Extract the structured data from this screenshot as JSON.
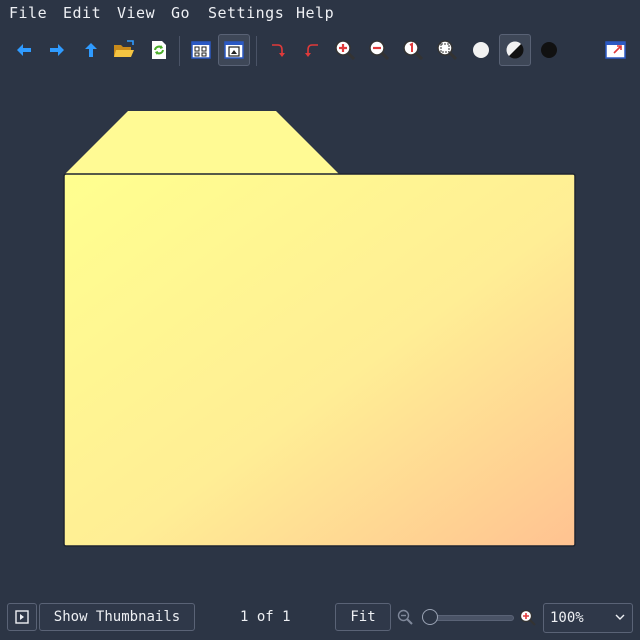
{
  "menu": [
    "File",
    "Edit",
    "View",
    "Go",
    "Settings",
    "Help"
  ],
  "toolbar": {
    "buttons": [
      {
        "name": "back-arrow-icon"
      },
      {
        "name": "forward-arrow-icon"
      },
      {
        "name": "up-arrow-icon"
      },
      {
        "name": "open-folder-icon"
      },
      {
        "name": "reload-icon"
      },
      {
        "name": "thumbnails-view-icon"
      },
      {
        "name": "image-view-icon",
        "active": true
      },
      {
        "name": "rotate-clockwise-icon"
      },
      {
        "name": "rotate-counterclockwise-icon"
      },
      {
        "name": "zoom-in-icon"
      },
      {
        "name": "zoom-out-icon"
      },
      {
        "name": "zoom-original-icon"
      },
      {
        "name": "zoom-fit-icon"
      },
      {
        "name": "light-background-icon"
      },
      {
        "name": "contrast-background-icon",
        "active": true
      },
      {
        "name": "dark-background-icon"
      },
      {
        "name": "fullscreen-icon"
      }
    ]
  },
  "viewer": {
    "image": "folder-icon",
    "colors": {
      "folder_light": "#ffff8f",
      "folder_dark": "#ffc291",
      "tab": "#fffa94"
    }
  },
  "statusbar": {
    "sidebar_toggle_icon": "sidebar-toggle-icon",
    "show_thumbnails_label": "Show Thumbnails",
    "page_indicator": "1 of 1",
    "fit_label": "Fit",
    "zoom_value": "100%",
    "zoom_slider_fraction": 0.0
  },
  "colors": {
    "background": "#2c3545",
    "accent_blue": "#2f9bff",
    "accent_red": "#e03a3a"
  }
}
